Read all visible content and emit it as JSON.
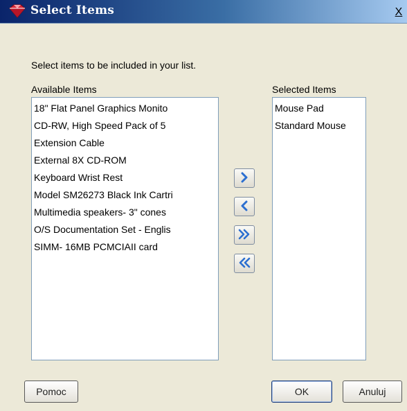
{
  "window": {
    "title": "Select Items",
    "close_label": "X"
  },
  "instruction": "Select items to be included in your list.",
  "available": {
    "label": "Available Items",
    "items": [
      "18\" Flat Panel Graphics Monito",
      "CD-RW, High Speed Pack of 5",
      "Extension Cable",
      "External 8X CD-ROM",
      "Keyboard Wrist Rest",
      "Model SM26273 Black Ink Cartri",
      "Multimedia speakers- 3\" cones",
      "O/S Documentation Set - Englis",
      "SIMM- 16MB PCMCIAII card"
    ]
  },
  "selected": {
    "label": "Selected Items",
    "items": [
      "Mouse Pad",
      "Standard Mouse"
    ]
  },
  "move_buttons": [
    {
      "name": "move-right-button",
      "icon": "chevron-right-icon"
    },
    {
      "name": "move-left-button",
      "icon": "chevron-left-icon"
    },
    {
      "name": "move-all-right-button",
      "icon": "double-chevron-right-icon"
    },
    {
      "name": "move-all-left-button",
      "icon": "double-chevron-left-icon"
    }
  ],
  "buttons": {
    "help": "Pomoc",
    "ok": "OK",
    "cancel": "Anuluj"
  },
  "colors": {
    "title_gradient_start": "#0a246a",
    "title_gradient_end": "#a6caf0",
    "dialog_bg": "#ece9d8",
    "arrow_blue": "#2c6fd0"
  }
}
